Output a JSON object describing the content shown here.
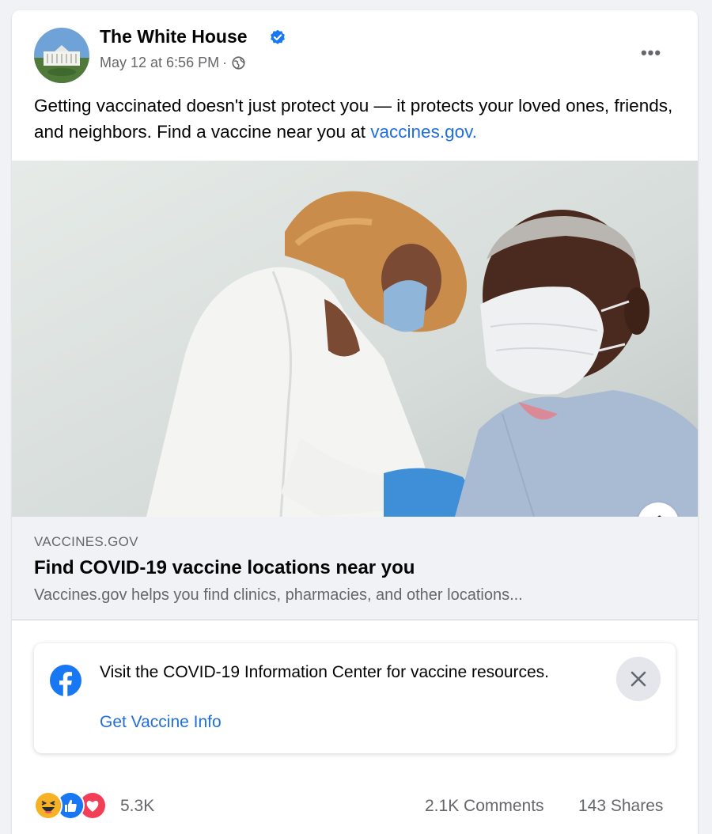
{
  "post": {
    "author": "The White House",
    "timestamp": "May 12 at 6:56 PM",
    "separator": "·",
    "text_before_link": "Getting vaccinated doesn't just protect you — it protects your loved ones, friends, and neighbors. Find a vaccine near you at ",
    "text_link": "vaccines.gov.",
    "more_label": "•••",
    "icons": {
      "verified": "verified-badge-icon",
      "privacy": "globe-icon",
      "info": "info-icon"
    }
  },
  "link_preview": {
    "domain": "VACCINES.GOV",
    "title": "Find COVID-19 vaccine locations near you",
    "description": "Vaccines.gov helps you find clinics, pharmacies, and other locations..."
  },
  "info_center": {
    "text": "Visit the COVID-19 Information Center for vaccine resources.",
    "link": "Get Vaccine Info"
  },
  "stats": {
    "reactions": "5.3K",
    "reaction_types": [
      "haha",
      "like",
      "love"
    ],
    "comments": "2.1K Comments",
    "shares": "143 Shares"
  },
  "colors": {
    "link_blue": "#216fdb",
    "secondary_text": "#65676b",
    "background": "#f0f2f5"
  }
}
